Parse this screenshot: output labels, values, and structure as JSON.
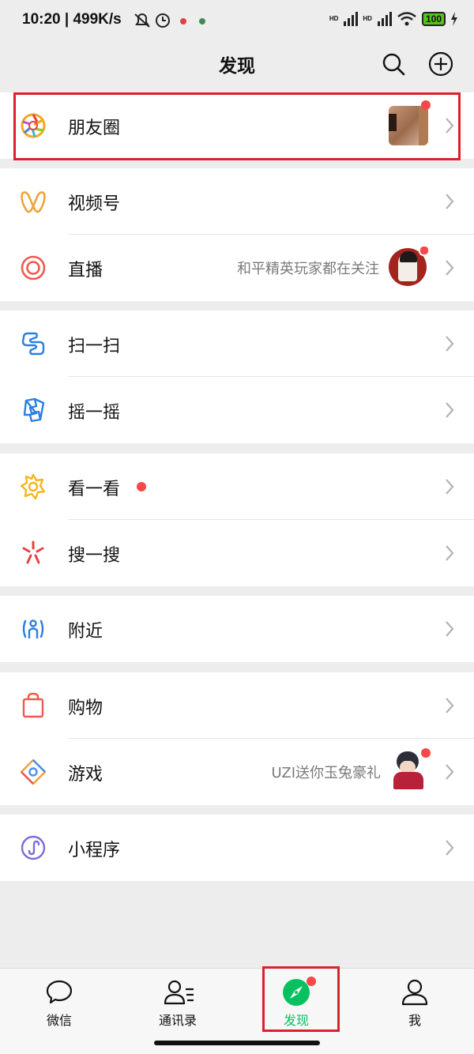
{
  "status_bar": {
    "time": "10:20",
    "speed": "499K/s",
    "battery": "100"
  },
  "header": {
    "title": "发现"
  },
  "menu": {
    "moments": "朋友圈",
    "channels": "视频号",
    "live": "直播",
    "live_sub": "和平精英玩家都在关注",
    "scan": "扫一扫",
    "shake": "摇一摇",
    "top_stories": "看一看",
    "search": "搜一搜",
    "nearby": "附近",
    "shopping": "购物",
    "games": "游戏",
    "games_sub": "UZI送你玉兔豪礼",
    "mini_programs": "小程序"
  },
  "tabs": {
    "chats": "微信",
    "contacts": "通讯录",
    "discover": "发现",
    "me": "我"
  },
  "colors": {
    "wechat_green": "#07c160",
    "red_dot": "#f5484a",
    "highlight_red": "#d9222a"
  },
  "icons": [
    "moments-icon",
    "channels-icon",
    "live-icon",
    "scan-icon",
    "shake-icon",
    "top-stories-icon",
    "search-icon",
    "nearby-icon",
    "shopping-icon",
    "games-icon",
    "mini-programs-icon",
    "chat-icon",
    "contacts-icon",
    "compass-icon",
    "person-icon",
    "plus-circle-icon",
    "chevron-right-icon"
  ]
}
